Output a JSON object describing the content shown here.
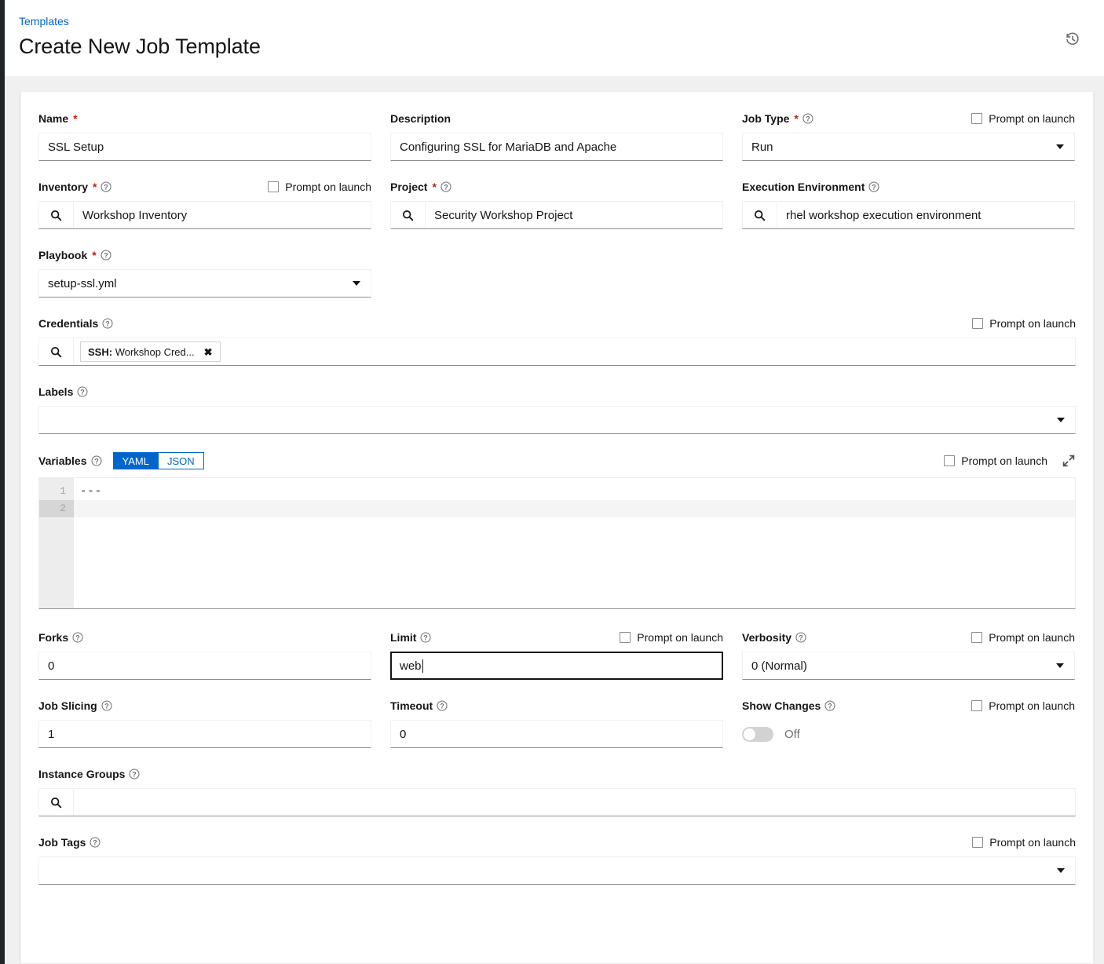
{
  "header": {
    "breadcrumb": "Templates",
    "title": "Create New Job Template",
    "history_icon": "history-icon"
  },
  "common": {
    "prompt_on_launch": "Prompt on launch",
    "required_mark": "*",
    "help_icon": "question-circle-icon",
    "search_icon": "search-icon",
    "expand_icon": "expand-arrows-icon"
  },
  "fields": {
    "name": {
      "label": "Name",
      "value": "SSL Setup",
      "required": true
    },
    "description": {
      "label": "Description",
      "value": "Configuring SSL for MariaDB and Apache",
      "required": false
    },
    "job_type": {
      "label": "Job Type",
      "value": "Run",
      "required": true,
      "prompt": "Prompt on launch"
    },
    "inventory": {
      "label": "Inventory",
      "value": "Workshop Inventory",
      "required": true,
      "prompt": "Prompt on launch"
    },
    "project": {
      "label": "Project",
      "value": "Security Workshop Project",
      "required": true
    },
    "execution_environment": {
      "label": "Execution Environment",
      "value": "rhel workshop execution environment",
      "required": false
    },
    "playbook": {
      "label": "Playbook",
      "value": "setup-ssl.yml",
      "required": true
    },
    "credentials": {
      "label": "Credentials",
      "prompt": "Prompt on launch",
      "chips": [
        {
          "prefix": "SSH:",
          "name": "Workshop Cred...",
          "close": "✖"
        }
      ]
    },
    "labels": {
      "label": "Labels",
      "value": ""
    },
    "variables": {
      "label": "Variables",
      "prompt": "Prompt on launch",
      "modes": [
        "YAML",
        "JSON"
      ],
      "active_mode": "YAML",
      "lines": [
        "---",
        ""
      ],
      "line_numbers": [
        "1",
        "2"
      ],
      "active_line": 2
    },
    "forks": {
      "label": "Forks",
      "value": "0"
    },
    "limit": {
      "label": "Limit",
      "value": "web",
      "prompt": "Prompt on launch",
      "focused": true
    },
    "verbosity": {
      "label": "Verbosity",
      "value": "0 (Normal)",
      "prompt": "Prompt on launch"
    },
    "job_slicing": {
      "label": "Job Slicing",
      "value": "1"
    },
    "timeout": {
      "label": "Timeout",
      "value": "0"
    },
    "show_changes": {
      "label": "Show Changes",
      "state": "Off",
      "prompt": "Prompt on launch",
      "on": false
    },
    "instance_groups": {
      "label": "Instance Groups",
      "value": ""
    },
    "job_tags": {
      "label": "Job Tags",
      "value": "",
      "prompt": "Prompt on launch"
    }
  },
  "colors": {
    "link": "#0066cc",
    "required": "#c9190b",
    "accent": "#0066cc",
    "page_bg": "#f0f0f0",
    "nav_dark": "#212427"
  }
}
